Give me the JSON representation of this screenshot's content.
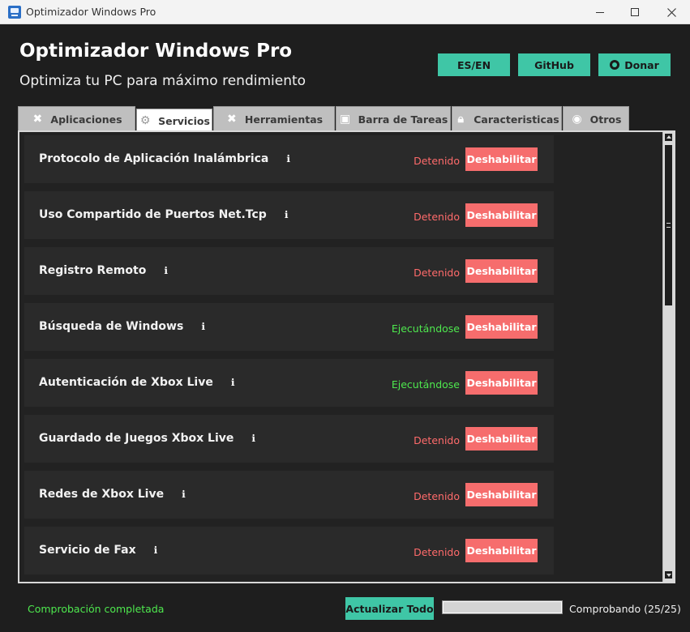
{
  "window": {
    "title": "Optimizador Windows Pro",
    "icon": "app-icon"
  },
  "header": {
    "title": "Optimizador Windows Pro",
    "subtitle": "Optimiza tu PC para máximo rendimiento",
    "buttons": {
      "language": "ES/EN",
      "github": "GitHub",
      "donate": "Donar"
    }
  },
  "tabs": [
    {
      "label": "Aplicaciones",
      "icon": "tools-icon",
      "active": false
    },
    {
      "label": "Servicios",
      "icon": "gear-icon",
      "active": true
    },
    {
      "label": "Herramientas",
      "icon": "tools-icon",
      "active": false
    },
    {
      "label": "Barra de Tareas",
      "icon": "taskbar-icon",
      "active": false
    },
    {
      "label": "Caracteristicas",
      "icon": "lock-icon",
      "active": false
    },
    {
      "label": "Otros",
      "icon": "palette-icon",
      "active": false
    }
  ],
  "services": [
    {
      "name": "Protocolo de Aplicación Inalámbrica",
      "status": "Detenido",
      "state": "stopped",
      "action": "Deshabilitar"
    },
    {
      "name": "Uso Compartido de Puertos Net.Tcp",
      "status": "Detenido",
      "state": "stopped",
      "action": "Deshabilitar"
    },
    {
      "name": "Registro Remoto",
      "status": "Detenido",
      "state": "stopped",
      "action": "Deshabilitar"
    },
    {
      "name": "Búsqueda de Windows",
      "status": "Ejecutándose",
      "state": "running",
      "action": "Deshabilitar"
    },
    {
      "name": "Autenticación de Xbox Live",
      "status": "Ejecutándose",
      "state": "running",
      "action": "Deshabilitar"
    },
    {
      "name": "Guardado de Juegos Xbox Live",
      "status": "Detenido",
      "state": "stopped",
      "action": "Deshabilitar"
    },
    {
      "name": "Redes de Xbox Live",
      "status": "Detenido",
      "state": "stopped",
      "action": "Deshabilitar"
    },
    {
      "name": "Servicio de Fax",
      "status": "Detenido",
      "state": "stopped",
      "action": "Deshabilitar"
    }
  ],
  "info_glyph": "ℹ",
  "footer": {
    "status": "Comprobación completada",
    "refresh_label": "Actualizar Todo",
    "progress_label": "Comprobando (25/25)",
    "progress_fraction": 1.0
  },
  "colors": {
    "accent": "#3fc6a6",
    "danger": "#f66d6d",
    "stopped_text": "#ff6b6b",
    "running_text": "#4ee84e",
    "background": "#1e1e1e"
  }
}
